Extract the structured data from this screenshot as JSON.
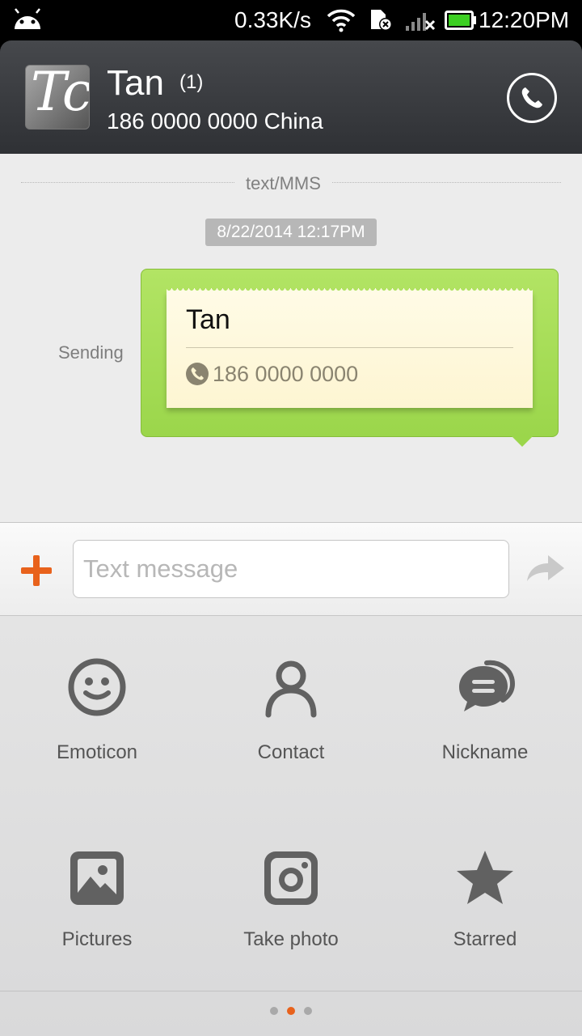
{
  "status_bar": {
    "net_speed": "0.33K/s",
    "time": "12:20PM",
    "battery_color": "#3ccf22"
  },
  "header": {
    "avatar_text": "Tc",
    "contact_name": "Tan",
    "unread_count": "(1)",
    "contact_number": "186 0000 0000 China",
    "call_icon": "phone-icon"
  },
  "conversation": {
    "message_type": "text/MMS",
    "timestamp": "8/22/2014 12:17PM",
    "status": "Sending",
    "card": {
      "name": "Tan",
      "phone": "186 0000 0000"
    },
    "bubble_color": "#9bd64b"
  },
  "composer": {
    "placeholder": "Text message",
    "add_icon": "plus-icon",
    "send_icon": "send-arrow-icon",
    "accent_color": "#e8621c"
  },
  "attachments": {
    "items": [
      {
        "label": "Emoticon",
        "icon": "smiley-icon"
      },
      {
        "label": "Contact",
        "icon": "person-icon"
      },
      {
        "label": "Nickname",
        "icon": "chat-bubbles-icon"
      },
      {
        "label": "Pictures",
        "icon": "picture-icon"
      },
      {
        "label": "Take photo",
        "icon": "camera-icon"
      },
      {
        "label": "Starred",
        "icon": "star-icon"
      }
    ],
    "page_count": 3,
    "active_page": 2
  }
}
